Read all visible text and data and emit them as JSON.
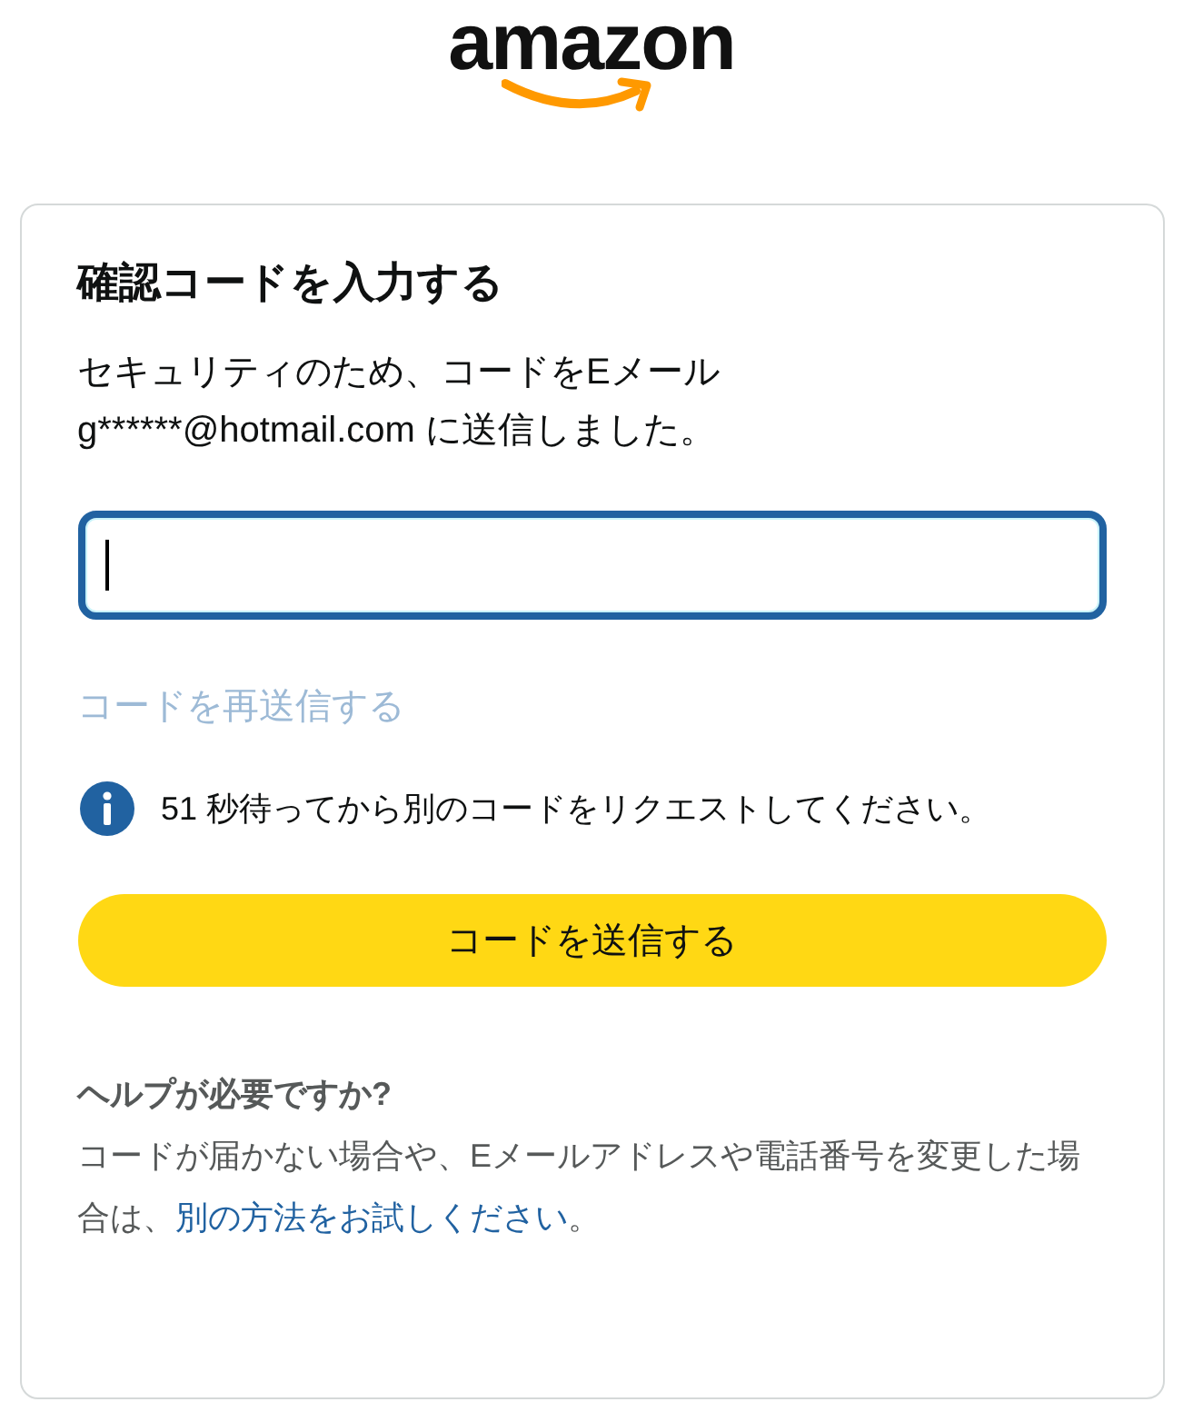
{
  "logo": {
    "text": "amazon"
  },
  "card": {
    "title": "確認コードを入力する",
    "message_lines": [
      "セキュリティのため、コードをEメール",
      "g******@hotmail.com に送信しました。"
    ],
    "code_field": {
      "focused": true
    },
    "resend_link": {
      "label": "コードを再送信する",
      "disabled": true
    },
    "info": {
      "text": "51 秒待ってから別のコードをリクエストしてください。"
    },
    "submit_button": {
      "label": "コードを送信する"
    },
    "help": {
      "title": "ヘルプが必要ですか?",
      "text": "コードが届かない場合や、Eメールアドレスや電話番号を変更した場合は、",
      "link": "別の方法をお試しください",
      "text_end": "。"
    }
  }
}
